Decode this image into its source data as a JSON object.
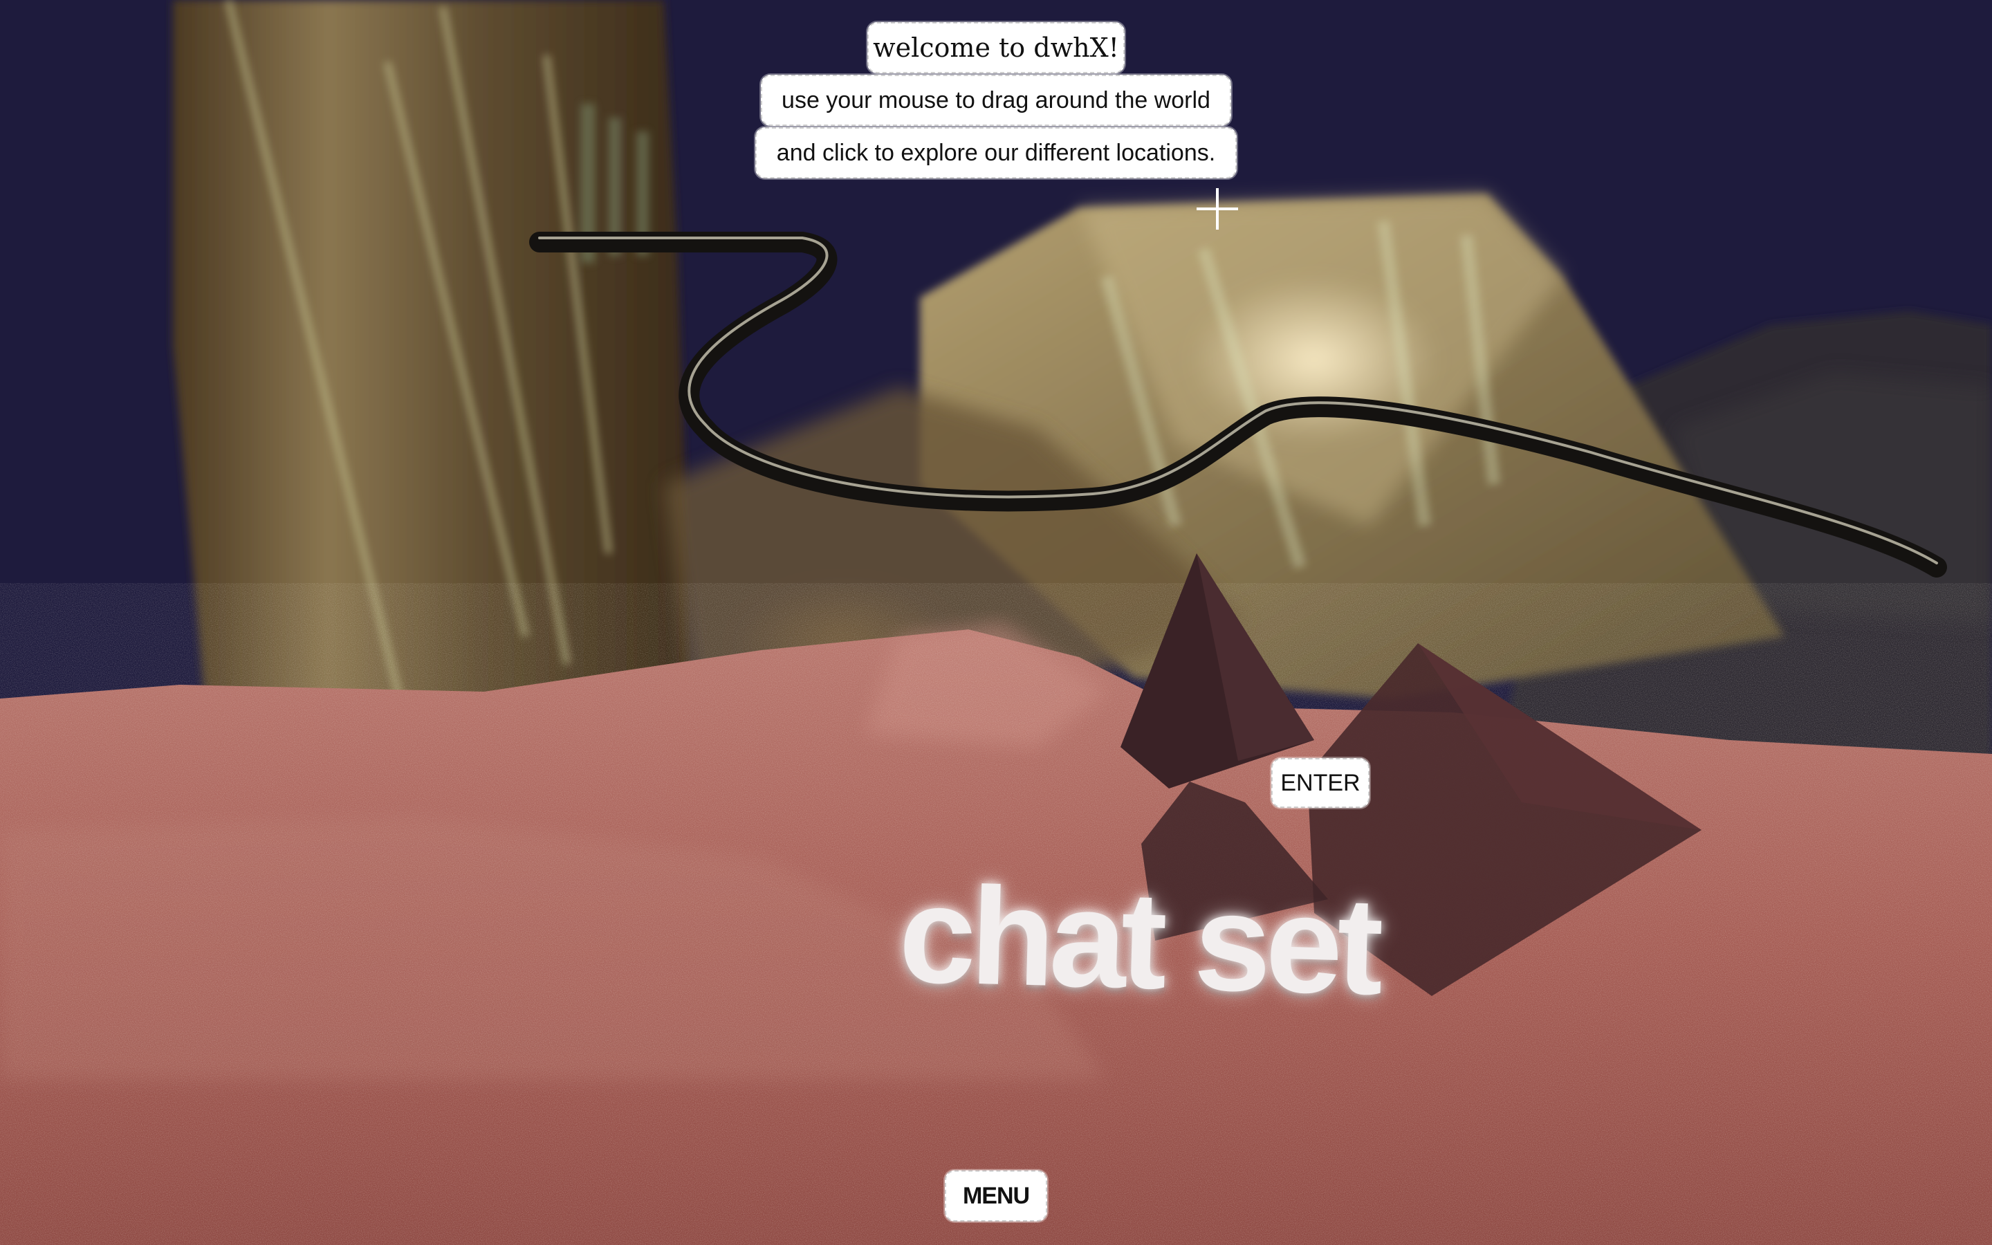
{
  "intro": {
    "welcome": "welcome to dwhX!",
    "instruction_line1": "use your mouse to drag around the world",
    "instruction_line2": "and click to explore our different locations."
  },
  "scene": {
    "location_label": "chat set",
    "enter_label": "ENTER"
  },
  "nav": {
    "menu_label": "MENU"
  },
  "colors": {
    "sky": "#1e1b3d",
    "ground": "#a8615a",
    "structure": "#7a6a48",
    "rock": "#2c2a2e"
  }
}
